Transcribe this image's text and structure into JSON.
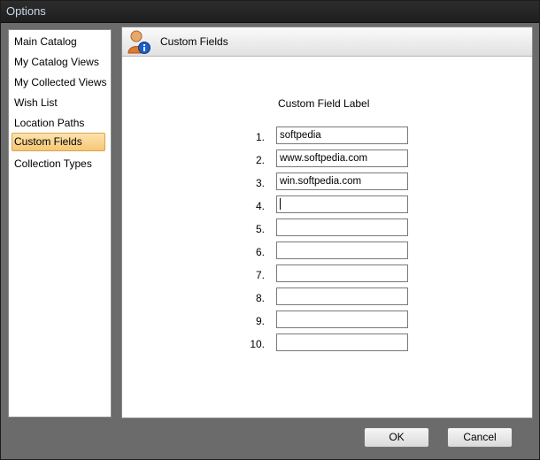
{
  "window": {
    "title": "Options"
  },
  "sidebar": {
    "items": [
      {
        "label": "Main Catalog"
      },
      {
        "label": "My Catalog Views"
      },
      {
        "label": "My Collected Views"
      },
      {
        "label": "Wish List"
      },
      {
        "label": "Location Paths"
      },
      {
        "label": "Custom Fields",
        "selected": true
      },
      {
        "label": "Collection Types"
      }
    ]
  },
  "panel": {
    "title": "Custom Fields",
    "icon": "user-info-icon",
    "column_heading": "Custom Field Label",
    "rows": [
      {
        "num": "1.",
        "value": "softpedia"
      },
      {
        "num": "2.",
        "value": "www.softpedia.com"
      },
      {
        "num": "3.",
        "value": "win.softpedia.com"
      },
      {
        "num": "4.",
        "value": ""
      },
      {
        "num": "5.",
        "value": ""
      },
      {
        "num": "6.",
        "value": ""
      },
      {
        "num": "7.",
        "value": ""
      },
      {
        "num": "8.",
        "value": ""
      },
      {
        "num": "9.",
        "value": ""
      },
      {
        "num": "10.",
        "value": ""
      }
    ]
  },
  "buttons": {
    "ok": "OK",
    "cancel": "Cancel"
  }
}
